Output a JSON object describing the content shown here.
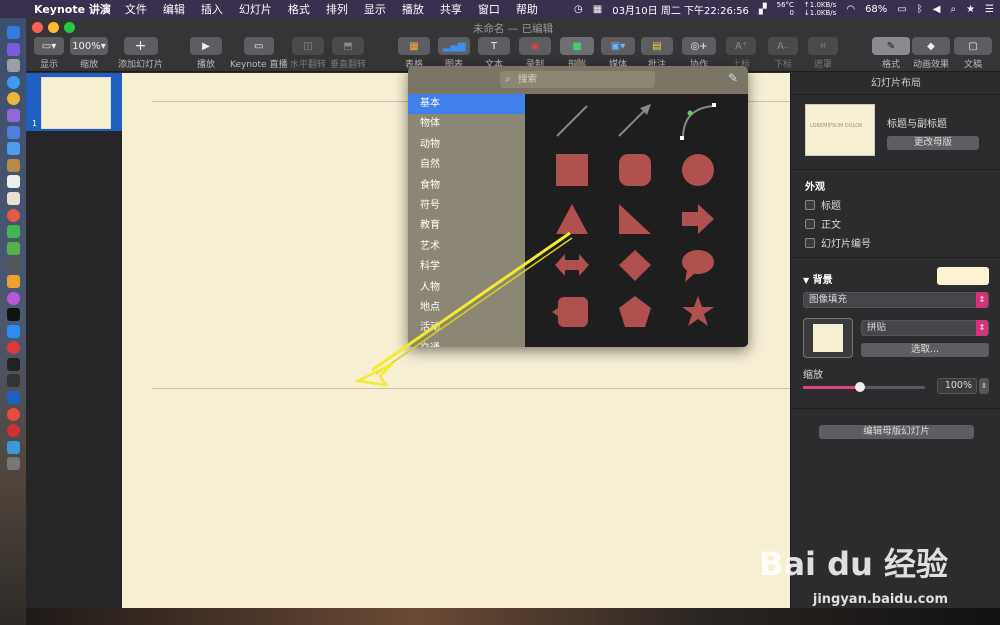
{
  "menubar": {
    "app_name": "Keynote 讲演",
    "items": [
      "文件",
      "编辑",
      "插入",
      "幻灯片",
      "格式",
      "排列",
      "显示",
      "播放",
      "共享",
      "窗口",
      "帮助"
    ],
    "sensor_temp": "56°C",
    "sensor_fan": "0",
    "net_up": "↑1.0KB/s",
    "net_down": "↓1.0KB/s",
    "datetime": "03月10日 周二 下午22:26:56",
    "battery": "68%"
  },
  "window": {
    "title": "未命名 — 已编辑"
  },
  "toolbar": {
    "view_label": "显示",
    "zoom_value": "100%",
    "zoom_label": "缩放",
    "add_slide_label": "添加幻灯片",
    "play_label": "播放",
    "keynote_live_label": "Keynote 直播",
    "flip_h_label": "水平翻转",
    "flip_v_label": "垂直翻转",
    "table_label": "表格",
    "chart_label": "图表",
    "text_label": "文本",
    "record_label": "录制",
    "shape_label": "形状",
    "media_label": "媒体",
    "comment_label": "批注",
    "collaborate_label": "协作",
    "superscript_label": "上标",
    "subscript_label": "下标",
    "mask_label": "遮罩",
    "format_label": "格式",
    "animate_label": "动画效果",
    "document_label": "文稿"
  },
  "navigator": {
    "slide_number": "1"
  },
  "shapes_popover": {
    "search_placeholder": "搜索",
    "categories": [
      "基本",
      "物体",
      "动物",
      "自然",
      "食物",
      "符号",
      "教育",
      "艺术",
      "科学",
      "人物",
      "地点",
      "活动",
      "交通"
    ],
    "selected_category": "基本",
    "shape_color": "#b0504f"
  },
  "inspector": {
    "header": "幻灯片布局",
    "layout_name": "标题与副标题",
    "thumb_text": "LOREMIPSUM DOLOR",
    "change_master_button": "更改母版",
    "appearance_title": "外观",
    "checkbox_title": "标题",
    "checkbox_body": "正文",
    "checkbox_slide_number": "幻灯片编号",
    "background_title": "背景",
    "background_color": "#fdf3d3",
    "fill_type": "图像填充",
    "tile_mode": "拼贴",
    "choose_button": "选取...",
    "scale_label": "缩放",
    "scale_value": "100%",
    "scale_fraction": 0.47,
    "edit_master_button": "编辑母版幻灯片"
  },
  "watermark": {
    "brand": "Bai du 经验",
    "url": "jingyan.baidu.com"
  }
}
